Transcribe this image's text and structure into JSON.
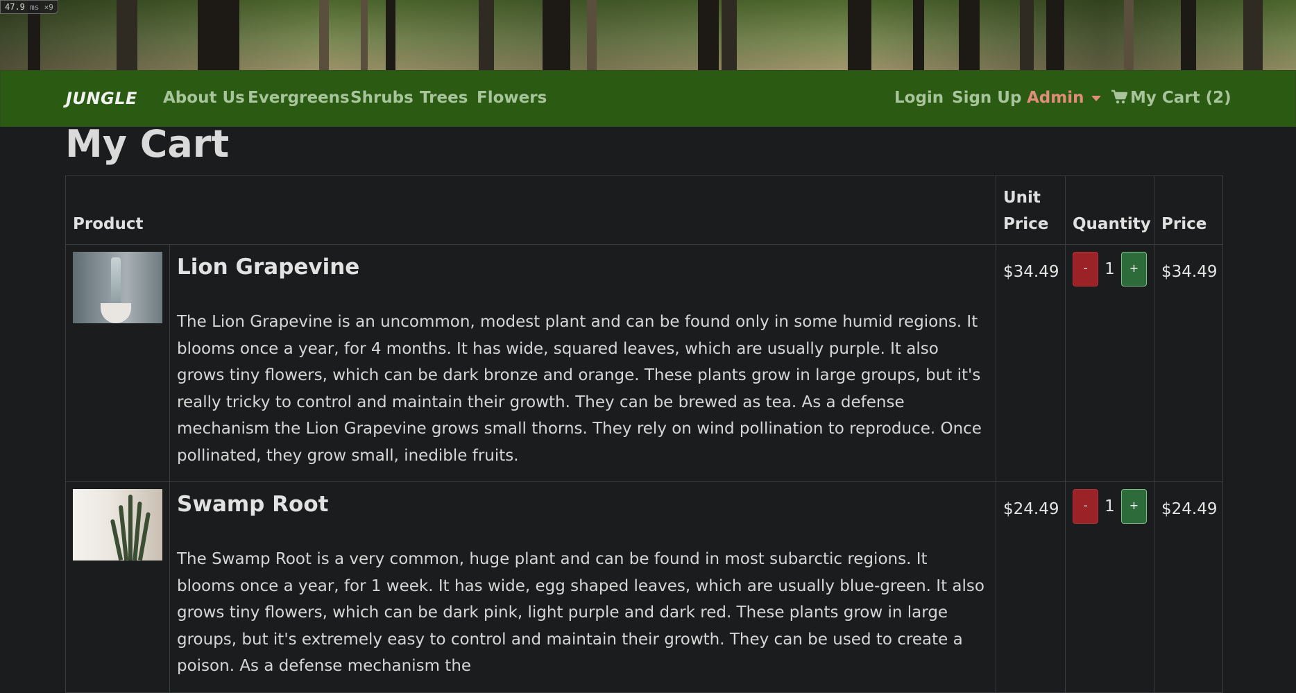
{
  "perf_badge": {
    "value": "47.9",
    "unit": "ms",
    "count": "×9"
  },
  "nav": {
    "brand": "JUNGLE",
    "links": [
      "About Us",
      "Evergreens",
      "Shrubs",
      "Trees",
      "Flowers"
    ],
    "login": "Login",
    "signup": "Sign Up",
    "admin": "Admin",
    "cart": "My Cart (2)",
    "accent_color": "#2b5a12"
  },
  "page": {
    "title": "My Cart"
  },
  "table": {
    "headers": {
      "product": "Product",
      "unit_price": "Unit Price",
      "quantity": "Quantity",
      "price": "Price"
    },
    "rows": [
      {
        "name": "Lion Grapevine",
        "description": "The Lion Grapevine is an uncommon, modest plant and can be found only in some humid regions. It blooms once a year, for 4 months. It has wide, squared leaves, which are usually purple. It also grows tiny flowers, which can be dark bronze and orange. These plants grow in large groups, but it's really tricky to control and maintain their growth. They can be brewed as tea. As a defense mechanism the Lion Grapevine grows small thorns. They rely on wind pollination to reproduce. Once pollinated, they grow small, inedible fruits.",
        "unit_price": "$34.49",
        "quantity": "1",
        "price": "$34.49",
        "minus": "-",
        "plus": "+"
      },
      {
        "name": "Swamp Root",
        "description": "The Swamp Root is a very common, huge plant and can be found in most subarctic regions. It blooms once a year, for 1 week. It has wide, egg shaped leaves, which are usually blue-green. It also grows tiny flowers, which can be dark pink, light purple and dark red. These plants grow in large groups, but it's extremely easy to control and maintain their growth. They can be used to create a poison. As a defense mechanism the",
        "unit_price": "$24.49",
        "quantity": "1",
        "price": "$24.49",
        "minus": "-",
        "plus": "+"
      }
    ]
  },
  "icons": {
    "cart": "shopping-cart-icon",
    "admin_dropdown": "caret-down-icon"
  }
}
